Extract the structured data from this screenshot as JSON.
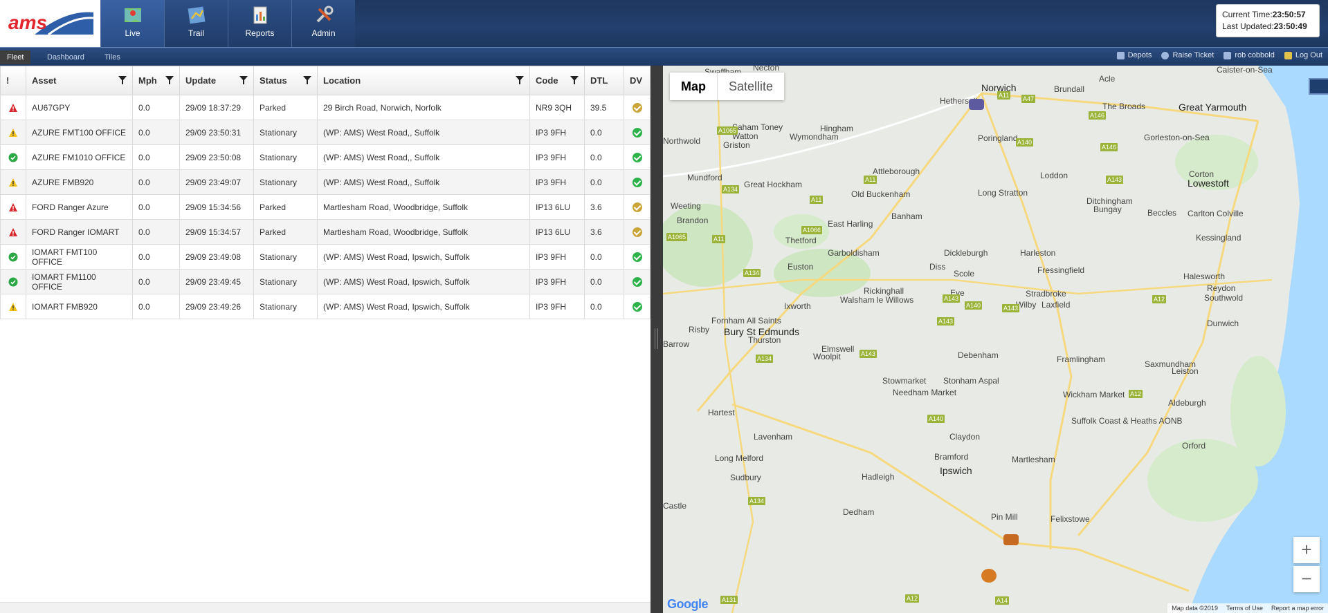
{
  "app": {
    "logo_text": "ams",
    "nav": [
      {
        "label": "Live",
        "icon": "map-icon",
        "active": true
      },
      {
        "label": "Trail",
        "icon": "trail-icon",
        "active": false
      },
      {
        "label": "Reports",
        "icon": "reports-icon",
        "active": false
      },
      {
        "label": "Admin",
        "icon": "tools-icon",
        "active": false
      }
    ],
    "time": {
      "current_label": "Current Time:",
      "current_value": "23:50:57",
      "updated_label": "Last Updated:",
      "updated_value": "23:50:49"
    }
  },
  "subnav": {
    "tabs": [
      "Fleet",
      "Dashboard",
      "Tiles"
    ],
    "links": [
      {
        "label": "Depots",
        "icon": "depot-icon"
      },
      {
        "label": "Raise Ticket",
        "icon": "help-icon"
      },
      {
        "label": "rob cobbold",
        "icon": "user-icon"
      },
      {
        "label": "Log Out",
        "icon": "lock-icon"
      }
    ]
  },
  "table": {
    "headers": [
      "!",
      "Asset",
      "Mph",
      "Update",
      "Status",
      "Location",
      "Code",
      "DTL",
      "DV"
    ],
    "rows": [
      {
        "alert": "red",
        "asset": "AU67GPY",
        "mph": "0.0",
        "update": "29/09 18:37:29",
        "status": "Parked",
        "location": "29 Birch Road, Norwich, Norfolk",
        "code": "NR9 3QH",
        "dtl": "39.5",
        "dv": "warn"
      },
      {
        "alert": "yellow",
        "asset": "AZURE FMT100 OFFICE",
        "mph": "0.0",
        "update": "29/09 23:50:31",
        "status": "Stationary",
        "location": "(WP: AMS) West Road,, Suffolk",
        "code": "IP3 9FH",
        "dtl": "0.0",
        "dv": "ok"
      },
      {
        "alert": "ok",
        "asset": "AZURE FM1010 OFFICE",
        "mph": "0.0",
        "update": "29/09 23:50:08",
        "status": "Stationary",
        "location": "(WP: AMS) West Road,, Suffolk",
        "code": "IP3 9FH",
        "dtl": "0.0",
        "dv": "ok"
      },
      {
        "alert": "yellow",
        "asset": "AZURE FMB920",
        "mph": "0.0",
        "update": "29/09 23:49:07",
        "status": "Stationary",
        "location": "(WP: AMS) West Road,, Suffolk",
        "code": "IP3 9FH",
        "dtl": "0.0",
        "dv": "ok"
      },
      {
        "alert": "red",
        "asset": "FORD Ranger Azure",
        "mph": "0.0",
        "update": "29/09 15:34:56",
        "status": "Parked",
        "location": "Martlesham Road, Woodbridge, Suffolk",
        "code": "IP13 6LU",
        "dtl": "3.6",
        "dv": "warn"
      },
      {
        "alert": "red",
        "asset": "FORD Ranger IOMART",
        "mph": "0.0",
        "update": "29/09 15:34:57",
        "status": "Parked",
        "location": "Martlesham Road, Woodbridge, Suffolk",
        "code": "IP13 6LU",
        "dtl": "3.6",
        "dv": "warn"
      },
      {
        "alert": "ok",
        "asset": "IOMART FMT100 OFFICE",
        "mph": "0.0",
        "update": "29/09 23:49:08",
        "status": "Stationary",
        "location": "(WP: AMS) West Road, Ipswich, Suffolk",
        "code": "IP3 9FH",
        "dtl": "0.0",
        "dv": "ok"
      },
      {
        "alert": "ok",
        "asset": "IOMART FM1100 OFFICE",
        "mph": "0.0",
        "update": "29/09 23:49:45",
        "status": "Stationary",
        "location": "(WP: AMS) West Road, Ipswich, Suffolk",
        "code": "IP3 9FH",
        "dtl": "0.0",
        "dv": "ok"
      },
      {
        "alert": "yellow",
        "asset": "IOMART FMB920",
        "mph": "0.0",
        "update": "29/09 23:49:26",
        "status": "Stationary",
        "location": "(WP: AMS) West Road, Ipswich, Suffolk",
        "code": "IP3 9FH",
        "dtl": "0.0",
        "dv": "ok"
      }
    ]
  },
  "map": {
    "type_buttons": [
      "Map",
      "Satellite"
    ],
    "zoom_in": "+",
    "zoom_out": "−",
    "google": "Google",
    "footer": [
      "Map data ©2019",
      "Terms of Use",
      "Report a map error"
    ],
    "places": [
      {
        "name": "Norwich",
        "big": true
      },
      {
        "name": "Swaffham"
      },
      {
        "name": "Necton"
      },
      {
        "name": "Acle"
      },
      {
        "name": "Brundall"
      },
      {
        "name": "Great Yarmouth",
        "big": true
      },
      {
        "name": "The Broads"
      },
      {
        "name": "Gorleston-on-Sea"
      },
      {
        "name": "Saham Toney"
      },
      {
        "name": "Watton"
      },
      {
        "name": "Hingham"
      },
      {
        "name": "Wymondham"
      },
      {
        "name": "Griston"
      },
      {
        "name": "Poringland"
      },
      {
        "name": "Loddon"
      },
      {
        "name": "Corton"
      },
      {
        "name": "Lowestoft",
        "big": true
      },
      {
        "name": "Mundford"
      },
      {
        "name": "Attleborough"
      },
      {
        "name": "Great Hockham"
      },
      {
        "name": "Old Buckenham"
      },
      {
        "name": "Long Stratton"
      },
      {
        "name": "Ditchingham"
      },
      {
        "name": "Bungay"
      },
      {
        "name": "Beccles"
      },
      {
        "name": "Carlton Colville"
      },
      {
        "name": "Weeting"
      },
      {
        "name": "Brandon"
      },
      {
        "name": "Banham"
      },
      {
        "name": "East Harling"
      },
      {
        "name": "Kessingland"
      },
      {
        "name": "Thetford"
      },
      {
        "name": "Garboldisham"
      },
      {
        "name": "Dickleburgh"
      },
      {
        "name": "Harleston"
      },
      {
        "name": "Euston"
      },
      {
        "name": "Diss"
      },
      {
        "name": "Scole"
      },
      {
        "name": "Fressingfield"
      },
      {
        "name": "Halesworth"
      },
      {
        "name": "Reydon"
      },
      {
        "name": "Southwold"
      },
      {
        "name": "Rickinghall"
      },
      {
        "name": "Stradbroke"
      },
      {
        "name": "Walsham le Willows"
      },
      {
        "name": "Ixworth"
      },
      {
        "name": "Eye"
      },
      {
        "name": "Wilby"
      },
      {
        "name": "Laxfield"
      },
      {
        "name": "Dunwich"
      },
      {
        "name": "Fornham All Saints"
      },
      {
        "name": "Risby"
      },
      {
        "name": "Bury St Edmunds",
        "big": true
      },
      {
        "name": "Thurston"
      },
      {
        "name": "Elmswell"
      },
      {
        "name": "Woolpit"
      },
      {
        "name": "Debenham"
      },
      {
        "name": "Framlingham"
      },
      {
        "name": "Saxmundham"
      },
      {
        "name": "Leiston"
      },
      {
        "name": "Stowmarket"
      },
      {
        "name": "Stonham Aspal"
      },
      {
        "name": "Needham Market"
      },
      {
        "name": "Wickham Market"
      },
      {
        "name": "Aldeburgh"
      },
      {
        "name": "Suffolk Coast & Heaths AONB"
      },
      {
        "name": "Hartest"
      },
      {
        "name": "Lavenham"
      },
      {
        "name": "Claydon"
      },
      {
        "name": "Orford"
      },
      {
        "name": "Long Melford"
      },
      {
        "name": "Bramford"
      },
      {
        "name": "Ipswich",
        "big": true
      },
      {
        "name": "Sudbury"
      },
      {
        "name": "Hadleigh"
      },
      {
        "name": "Hethersett"
      },
      {
        "name": "Martlesham"
      },
      {
        "name": "Pin Mill"
      },
      {
        "name": "Felixstowe"
      },
      {
        "name": "Dedham"
      },
      {
        "name": "Castle"
      },
      {
        "name": "Barrow"
      },
      {
        "name": "Caister-on-Sea"
      },
      {
        "name": "Northwold"
      }
    ],
    "roads": [
      "A11",
      "A47",
      "A146",
      "A1065",
      "A140",
      "A146",
      "A143",
      "A134",
      "A11",
      "A11",
      "A1066",
      "A143",
      "A1065",
      "A11",
      "A134",
      "A140",
      "A143",
      "A12",
      "A143",
      "A134",
      "A143",
      "A12",
      "A140",
      "A134",
      "A131",
      "A12",
      "A14"
    ]
  }
}
